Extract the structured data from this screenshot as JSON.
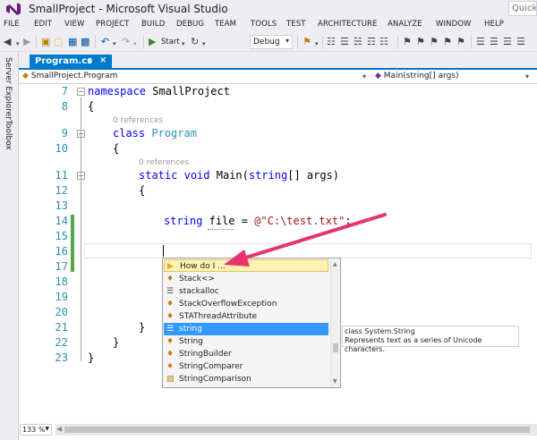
{
  "window": {
    "title": "SmallProject - Microsoft Visual Studio",
    "quick_launch_placeholder": "Quick",
    "logo_icon": "visual-studio-logo",
    "accent_color": "#007acc"
  },
  "menu": [
    "FILE",
    "EDIT",
    "VIEW",
    "PROJECT",
    "BUILD",
    "DEBUG",
    "TEAM",
    "TOOLS",
    "TEST",
    "ARCHITECTURE",
    "ANALYZE",
    "WINDOW",
    "HELP"
  ],
  "toolbar": {
    "start_label": "Start",
    "config_value": "Debug"
  },
  "side_rail": {
    "server_explorer": "Server Explorer",
    "toolbox": "Toolbox"
  },
  "tab": {
    "label": "Program.cs",
    "pin_icon": "pin-icon",
    "close_icon": "close-icon"
  },
  "navbar": {
    "type_scope": "SmallProject.Program",
    "member_scope": "Main(string[] args)"
  },
  "editor": {
    "lines": [
      {
        "num": "7",
        "code": "namespace SmallProject"
      },
      {
        "num": "8",
        "code": "{"
      },
      {
        "num": "9",
        "code": "class Program",
        "refs": "0 references"
      },
      {
        "num": "10",
        "code": "{"
      },
      {
        "num": "11",
        "code": "static void Main(string[] args)",
        "refs": "0 references"
      },
      {
        "num": "12",
        "code": "{"
      },
      {
        "num": "13",
        "code": ""
      },
      {
        "num": "14",
        "code": "string file = @\"C:\\test.txt\";"
      },
      {
        "num": "15",
        "code": ""
      },
      {
        "num": "16",
        "code": ""
      },
      {
        "num": "17",
        "code": ""
      },
      {
        "num": "18",
        "code": ""
      },
      {
        "num": "19",
        "code": ""
      },
      {
        "num": "20",
        "code": ""
      },
      {
        "num": "21",
        "code": "}"
      },
      {
        "num": "22",
        "code": "}"
      },
      {
        "num": "23",
        "code": "}"
      }
    ],
    "tokens": {
      "namespace_kw": "namespace",
      "namespace_name": "SmallProject",
      "open_brace": "{",
      "close_brace": "}",
      "class_kw": "class",
      "class_name": "Program",
      "static_kw": "static",
      "void_kw": "void",
      "main_sig_a": "Main(",
      "main_string": "string",
      "main_sig_b": "[] args)",
      "string_kw": "string",
      "var_name": "file",
      "assign": " = ",
      "string_literal": "@\"C:\\test.txt\"",
      "semicolon": ";",
      "refs_label": "0 references"
    }
  },
  "completion_list": {
    "items": [
      {
        "label": "How do I ...",
        "icon": "lightbulb-icon"
      },
      {
        "label": "Stack<>",
        "icon": "class-icon"
      },
      {
        "label": "stackalloc",
        "icon": "keyword-icon"
      },
      {
        "label": "StackOverflowException",
        "icon": "class-icon"
      },
      {
        "label": "STAThreadAttribute",
        "icon": "class-icon"
      },
      {
        "label": "string",
        "icon": "keyword-icon",
        "selected": true
      },
      {
        "label": "String",
        "icon": "class-icon"
      },
      {
        "label": "StringBuilder",
        "icon": "class-icon"
      },
      {
        "label": "StringComparer",
        "icon": "class-icon"
      },
      {
        "label": "StringComparison",
        "icon": "enum-icon"
      }
    ]
  },
  "tooltip": {
    "line1": "class System.String",
    "line2": "Represents text as a series of Unicode characters."
  },
  "status": {
    "zoom": "133 %"
  },
  "annotation": {
    "arrow_color": "#e8336e"
  }
}
